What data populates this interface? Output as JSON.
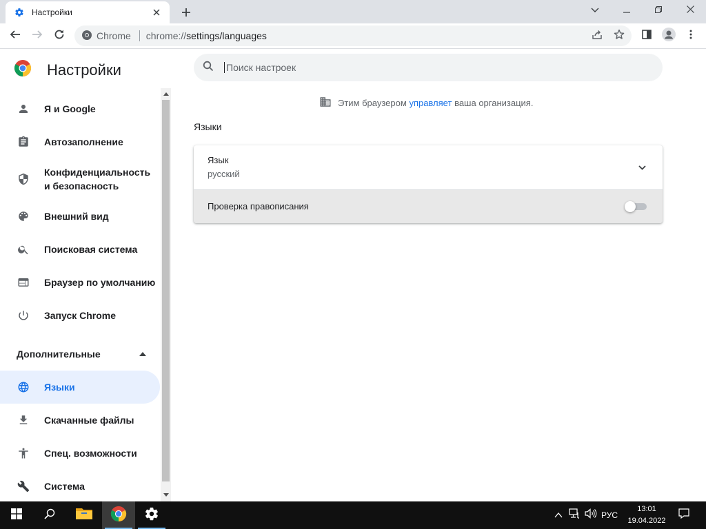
{
  "browser": {
    "tab": {
      "title": "Настройки",
      "favicon": "gear-icon"
    },
    "window_controls": [
      "chevron-down-icon",
      "minimize-icon",
      "restore-icon",
      "close-icon"
    ],
    "omnibox": {
      "site_chip": "Chrome",
      "url_host": "chrome://",
      "url_path": "settings/languages"
    }
  },
  "settings": {
    "title": "Настройки",
    "search": {
      "placeholder": "Поиск настроек"
    },
    "sidebar": {
      "items": [
        {
          "label": "Я и Google",
          "icon": "person-icon"
        },
        {
          "label": "Автозаполнение",
          "icon": "clipboard-icon"
        },
        {
          "label": "Конфиденциальность и безопасность",
          "icon": "shield-icon"
        },
        {
          "label": "Внешний вид",
          "icon": "palette-icon"
        },
        {
          "label": "Поисковая система",
          "icon": "search-icon"
        },
        {
          "label": "Браузер по умолчанию",
          "icon": "browser-window-icon"
        },
        {
          "label": "Запуск Chrome",
          "icon": "power-icon"
        }
      ],
      "advanced": {
        "label": "Дополнительные",
        "expanded": true
      },
      "advanced_items": [
        {
          "label": "Языки",
          "icon": "globe-icon",
          "active": true
        },
        {
          "label": "Скачанные файлы",
          "icon": "download-icon"
        },
        {
          "label": "Спец. возможности",
          "icon": "accessibility-icon"
        },
        {
          "label": "Система",
          "icon": "wrench-icon"
        }
      ]
    },
    "managed_notice": {
      "before": "Этим браузером",
      "link": "управляет",
      "after": "ваша организация."
    },
    "section_title": "Языки",
    "language_row": {
      "label": "Язык",
      "value": "русский"
    },
    "spellcheck_row": {
      "label": "Проверка правописания",
      "enabled": false
    }
  },
  "taskbar": {
    "apps": [
      "windows-start-icon",
      "search-icon",
      "file-explorer-icon",
      "chrome-icon",
      "settings-gear-icon"
    ],
    "language": "РУС",
    "time": "13:01",
    "date": "19.04.2022"
  },
  "colors": {
    "accent": "#1a73e8",
    "active_nav_bg": "#e8f0fe",
    "taskbar": "#101010",
    "tabstrip": "#dee1e6"
  }
}
